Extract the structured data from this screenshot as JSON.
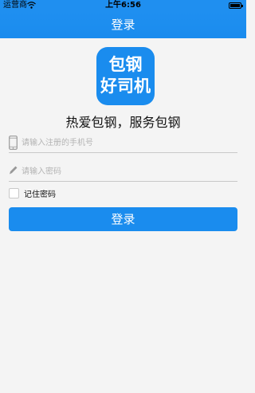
{
  "status_bar": {
    "carrier": "运营商",
    "time": "上午6:56",
    "wifi_icon": "wifi-icon",
    "battery_icon": "battery-full-icon"
  },
  "nav": {
    "title": "登录"
  },
  "logo": {
    "line1": "包钢",
    "line2": "好司机"
  },
  "slogan": "热爱包钢，服务包钢",
  "form": {
    "phone_placeholder": "请输入注册的手机号",
    "phone_icon": "phone-icon",
    "password_placeholder": "请输入密码",
    "password_icon": "pencil-icon",
    "remember_label": "记住密码",
    "remember_checked": false,
    "submit_label": "登录"
  },
  "colors": {
    "accent": "#1a8cee",
    "background": "#f4f4f4",
    "placeholder": "#b4b4b4"
  }
}
